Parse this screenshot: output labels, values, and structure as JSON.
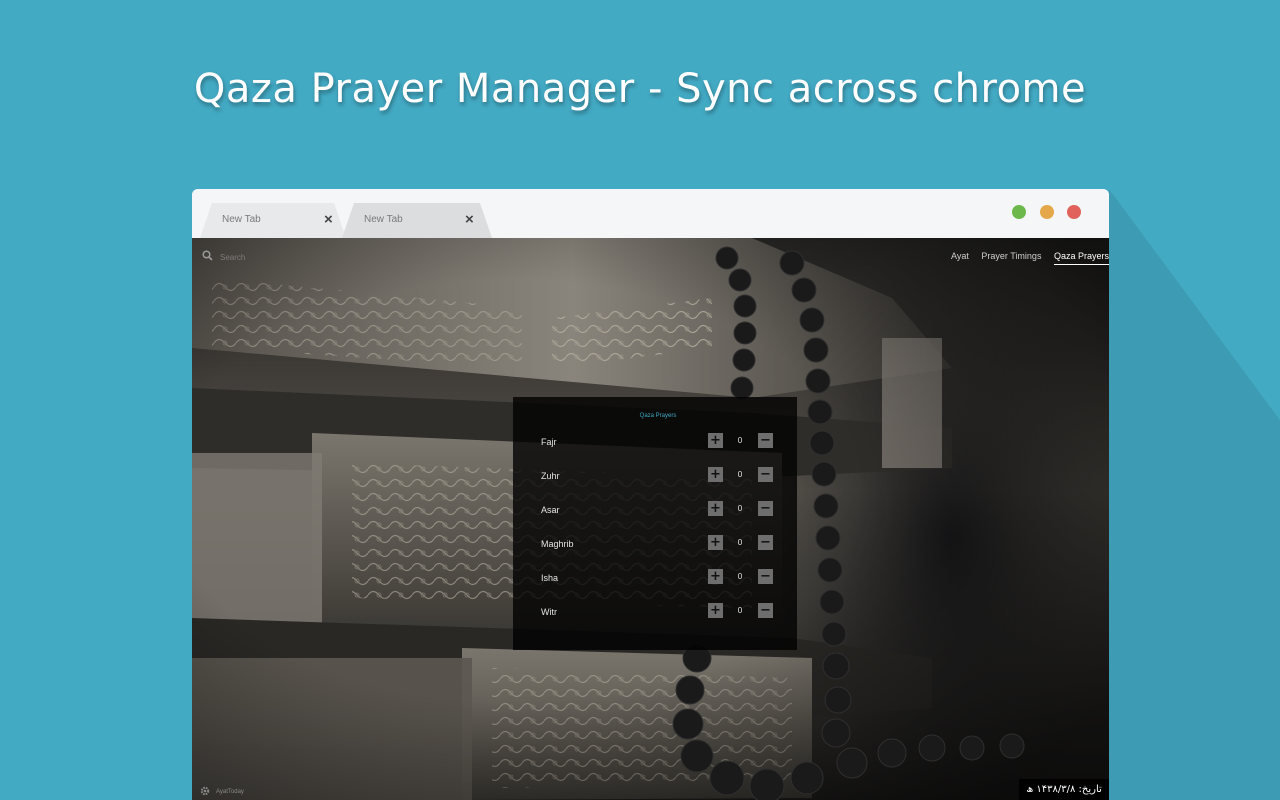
{
  "headline": "Qaza Prayer Manager - Sync across chrome",
  "tabs": [
    {
      "label": "New Tab",
      "close": "×"
    },
    {
      "label": "New Tab",
      "close": "×"
    }
  ],
  "window_controls": {
    "colors": {
      "minimize": "#6cb84a",
      "maximize": "#e4a84a",
      "close": "#e0625a"
    }
  },
  "search": {
    "placeholder": "Search",
    "icon": "search-icon"
  },
  "nav": {
    "ayat": "Ayat",
    "prayer_timings": "Prayer Timings",
    "qaza_prayers": "Qaza Prayers"
  },
  "panel": {
    "title": "Qaza Prayers",
    "plus_symbol": "+",
    "minus_symbol": "−",
    "prayers": [
      {
        "name": "Fajr",
        "count": "0"
      },
      {
        "name": "Zuhr",
        "count": "0"
      },
      {
        "name": "Asar",
        "count": "0"
      },
      {
        "name": "Maghrib",
        "count": "0"
      },
      {
        "name": "Isha",
        "count": "0"
      },
      {
        "name": "Witr",
        "count": "0"
      }
    ]
  },
  "footer": {
    "brand": "AyatToday",
    "hijri_date": "تاریخ: ۱۴۳۸/۳/۸ ھ"
  },
  "colors": {
    "background": "#43aac4",
    "accent": "#3fa9c4"
  }
}
